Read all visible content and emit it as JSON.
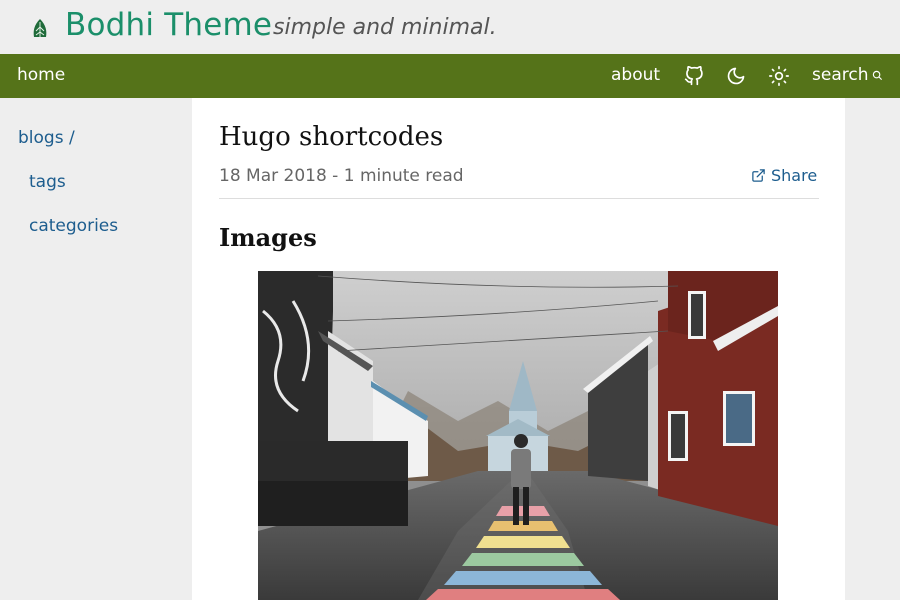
{
  "header": {
    "title": "Bodhi Theme",
    "tagline": "simple and minimal.",
    "logo_icon": "leaf-icon",
    "brand_color": "#1b8f6a"
  },
  "nav": {
    "home": "home",
    "about": "about",
    "github_icon": "github-icon",
    "dark_icon": "moon-icon",
    "light_icon": "sun-icon",
    "search": "search",
    "search_icon": "search-icon",
    "bar_color": "#557319"
  },
  "sidebar": {
    "items": [
      {
        "label": "blogs /"
      },
      {
        "label": "tags"
      },
      {
        "label": "categories"
      }
    ],
    "link_color": "#1d5d8e"
  },
  "post": {
    "title": "Hugo shortcodes",
    "meta": "18 Mar 2018 - 1 minute read",
    "share": "Share",
    "share_icon": "external-link-icon",
    "section_heading": "Images",
    "image_description": "street-photo"
  }
}
